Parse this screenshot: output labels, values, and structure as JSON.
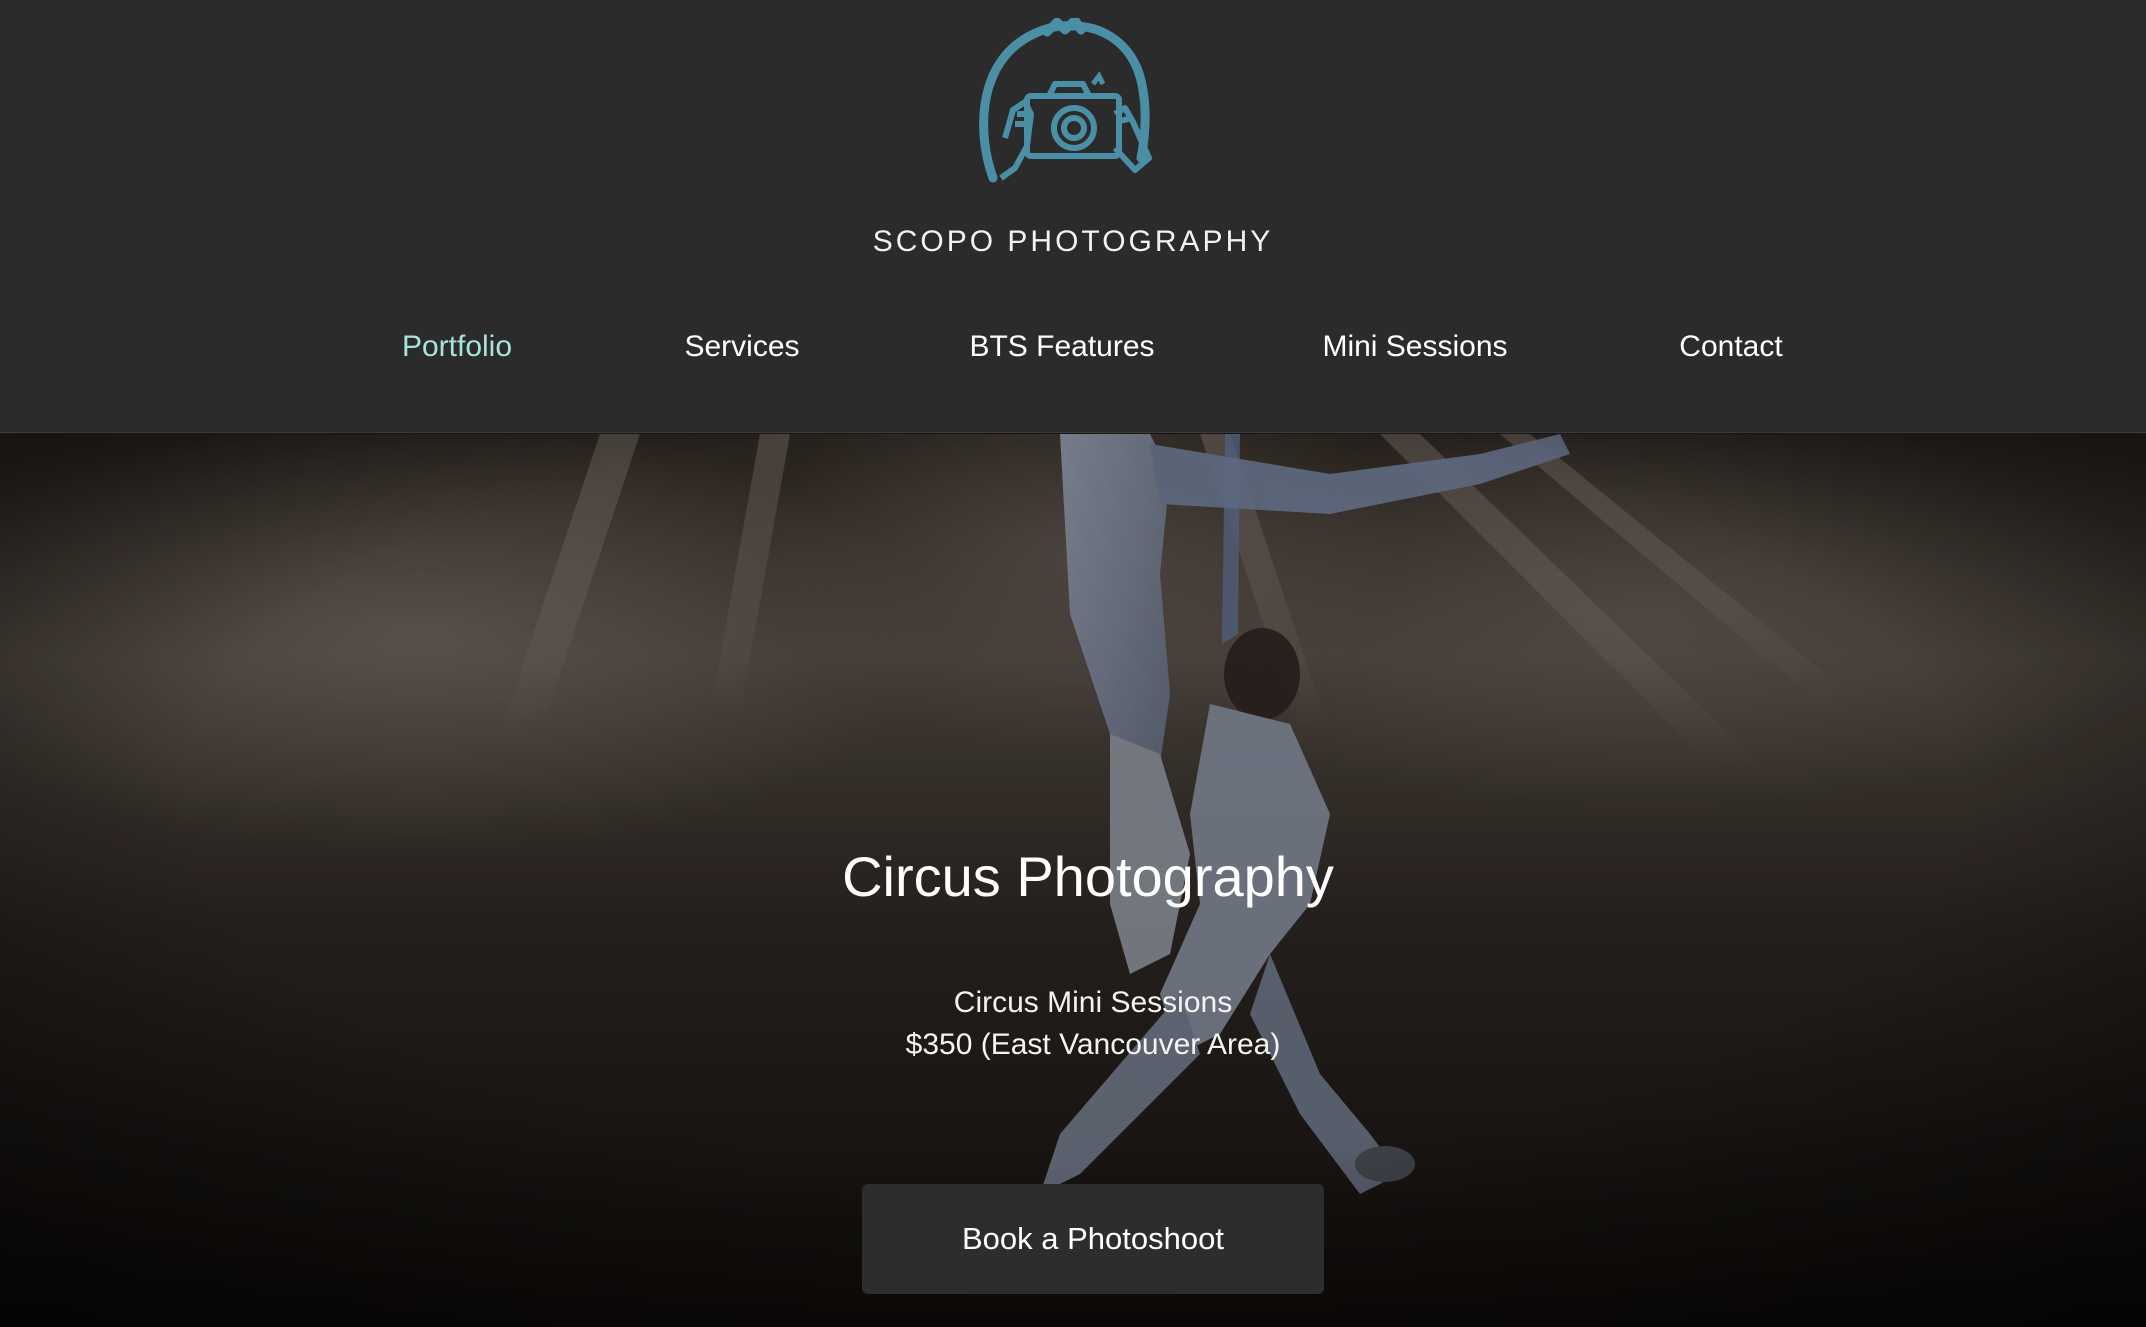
{
  "brand": {
    "name": "SCOPO PHOTOGRAPHY",
    "logo_icon": "camera-mascot-logo",
    "logo_color": "#4a8fa6"
  },
  "nav": {
    "items": [
      {
        "label": "Portfolio",
        "active": true
      },
      {
        "label": "Services",
        "active": false
      },
      {
        "label": "BTS Features",
        "active": false
      },
      {
        "label": "Mini Sessions",
        "active": false
      },
      {
        "label": "Contact",
        "active": false
      }
    ],
    "active_color": "#a9e3dc"
  },
  "hero": {
    "title": "Circus Photography",
    "subtitle_line1": "Circus Mini Sessions",
    "subtitle_line2": "$350 (East Vancouver Area)",
    "cta_label": "Book a Photoshoot"
  },
  "colors": {
    "header_bg": "#2b2b2b",
    "button_bg": "#2d2d2d"
  }
}
